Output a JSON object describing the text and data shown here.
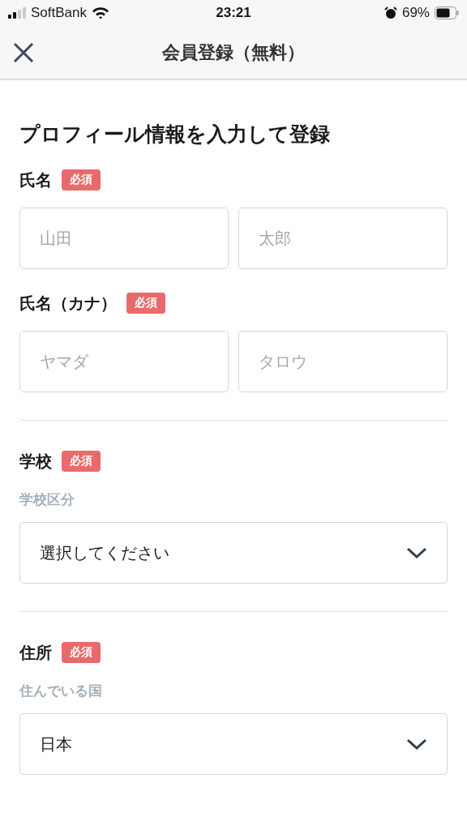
{
  "status_bar": {
    "carrier": "SoftBank",
    "time": "23:21",
    "battery": "69%"
  },
  "header": {
    "title": "会員登録（無料）"
  },
  "heading": "プロフィール情報を入力して登録",
  "sections": [
    {
      "kind": "pair",
      "label": "氏名",
      "badge": "必須",
      "fields": [
        {
          "placeholder": "山田"
        },
        {
          "placeholder": "太郎"
        }
      ]
    },
    {
      "kind": "pair",
      "label": "氏名（カナ）",
      "badge": "必須",
      "fields": [
        {
          "placeholder": "ヤマダ"
        },
        {
          "placeholder": "タロウ"
        }
      ]
    },
    {
      "kind": "select",
      "label": "学校",
      "badge": "必須",
      "sublabel": "学校区分",
      "value": "選択してください"
    },
    {
      "kind": "select",
      "label": "住所",
      "badge": "必須",
      "sublabel": "住んでいる国",
      "value": "日本"
    }
  ]
}
